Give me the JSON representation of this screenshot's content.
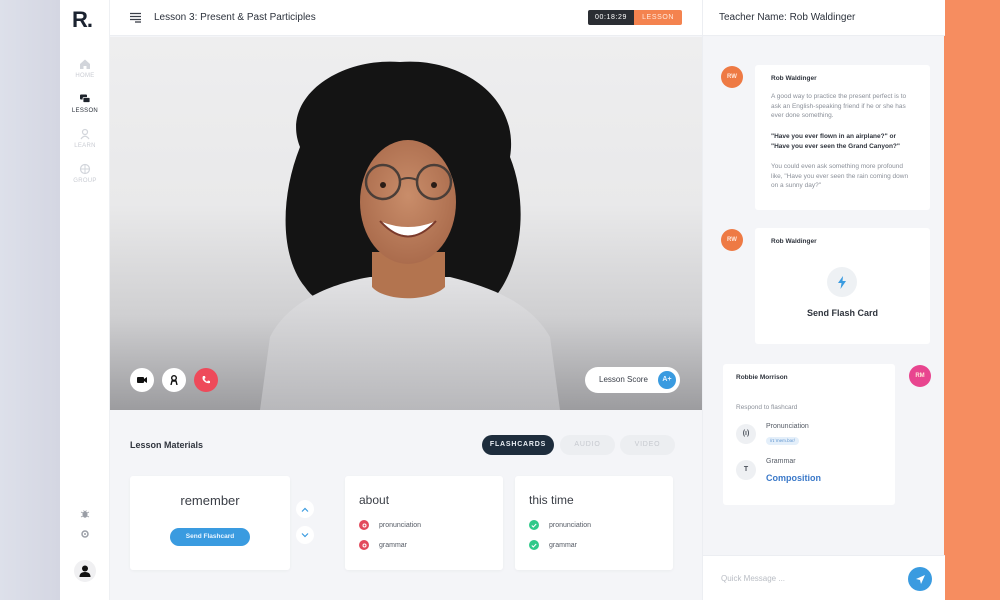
{
  "app": {
    "logo": "R.",
    "accent_orange": "#f4834f",
    "accent_blue": "#3a9be0"
  },
  "sidebar": {
    "items": [
      {
        "label": "HOME",
        "icon": "home-icon",
        "active": false
      },
      {
        "label": "LESSON",
        "icon": "chat-bubbles-icon",
        "active": true
      },
      {
        "label": "LEARN",
        "icon": "person-icon",
        "active": false
      },
      {
        "label": "GROUP",
        "icon": "globe-icon",
        "active": false
      }
    ],
    "bottom_icons": [
      "bug-icon",
      "settings-icon"
    ],
    "user_avatar": "user-avatar-icon"
  },
  "header": {
    "title": "Lesson 3: Present & Past Participles",
    "timer": "00:18:29",
    "tag": "LESSON"
  },
  "video": {
    "controls": [
      "camera-icon",
      "profile-icon",
      "end-call-icon"
    ],
    "lesson_score_label": "Lesson Score",
    "lesson_score_value": "A+"
  },
  "materials": {
    "title": "Lesson Materials",
    "tabs": [
      {
        "label": "FLASHCARDS",
        "active": true
      },
      {
        "label": "AUDIO",
        "active": false
      },
      {
        "label": "VIDEO",
        "active": false
      }
    ],
    "flashcard": {
      "word": "remember",
      "button": "Send Flashcard"
    },
    "cards": [
      {
        "title": "about",
        "items": [
          {
            "label": "pronunciation",
            "status": "incorrect"
          },
          {
            "label": "grammar",
            "status": "incorrect"
          }
        ]
      },
      {
        "title": "this time",
        "items": [
          {
            "label": "pronunciation",
            "status": "correct"
          },
          {
            "label": "grammar",
            "status": "correct"
          }
        ]
      }
    ]
  },
  "chat": {
    "teacher_label": "Teacher Name: Rob Waldinger",
    "messages": [
      {
        "author": "Rob Waldinger",
        "initials": "RW",
        "paragraphs": [
          "A good way to practice the present perfect is to ask an English-speaking friend if he or she has ever done something.",
          "\"Have you ever flown in an airplane?\" or \"Have you ever seen the Grand Canyon?\"",
          "You could even ask something more profound like, \"Have you ever seen the rain coming down on a sunny day?\""
        ]
      },
      {
        "author": "Rob Waldinger",
        "initials": "RW",
        "action_label": "Send Flash Card"
      },
      {
        "author": "Robbie Morrison",
        "initials": "RM",
        "prompt": "Respond to flashcard",
        "responses": [
          {
            "icon_text": "(ı)",
            "name": "Pronunciation",
            "value": "/rɪˈmem.bər/"
          },
          {
            "icon_text": "T",
            "name": "Grammar",
            "value": "Composition"
          }
        ]
      }
    ],
    "quick_message_placeholder": "Quick Message ..."
  }
}
